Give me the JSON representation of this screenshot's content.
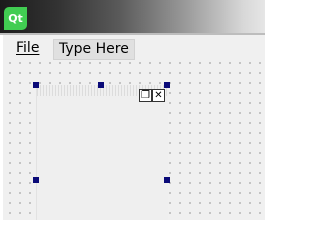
{
  "window": {
    "logo_text": "Qt"
  },
  "menubar": {
    "items": [
      {
        "label": "File"
      },
      {
        "label": "Type Here"
      }
    ]
  },
  "subwindow": {
    "restore_symbol": "❐",
    "close_symbol": "✕"
  }
}
